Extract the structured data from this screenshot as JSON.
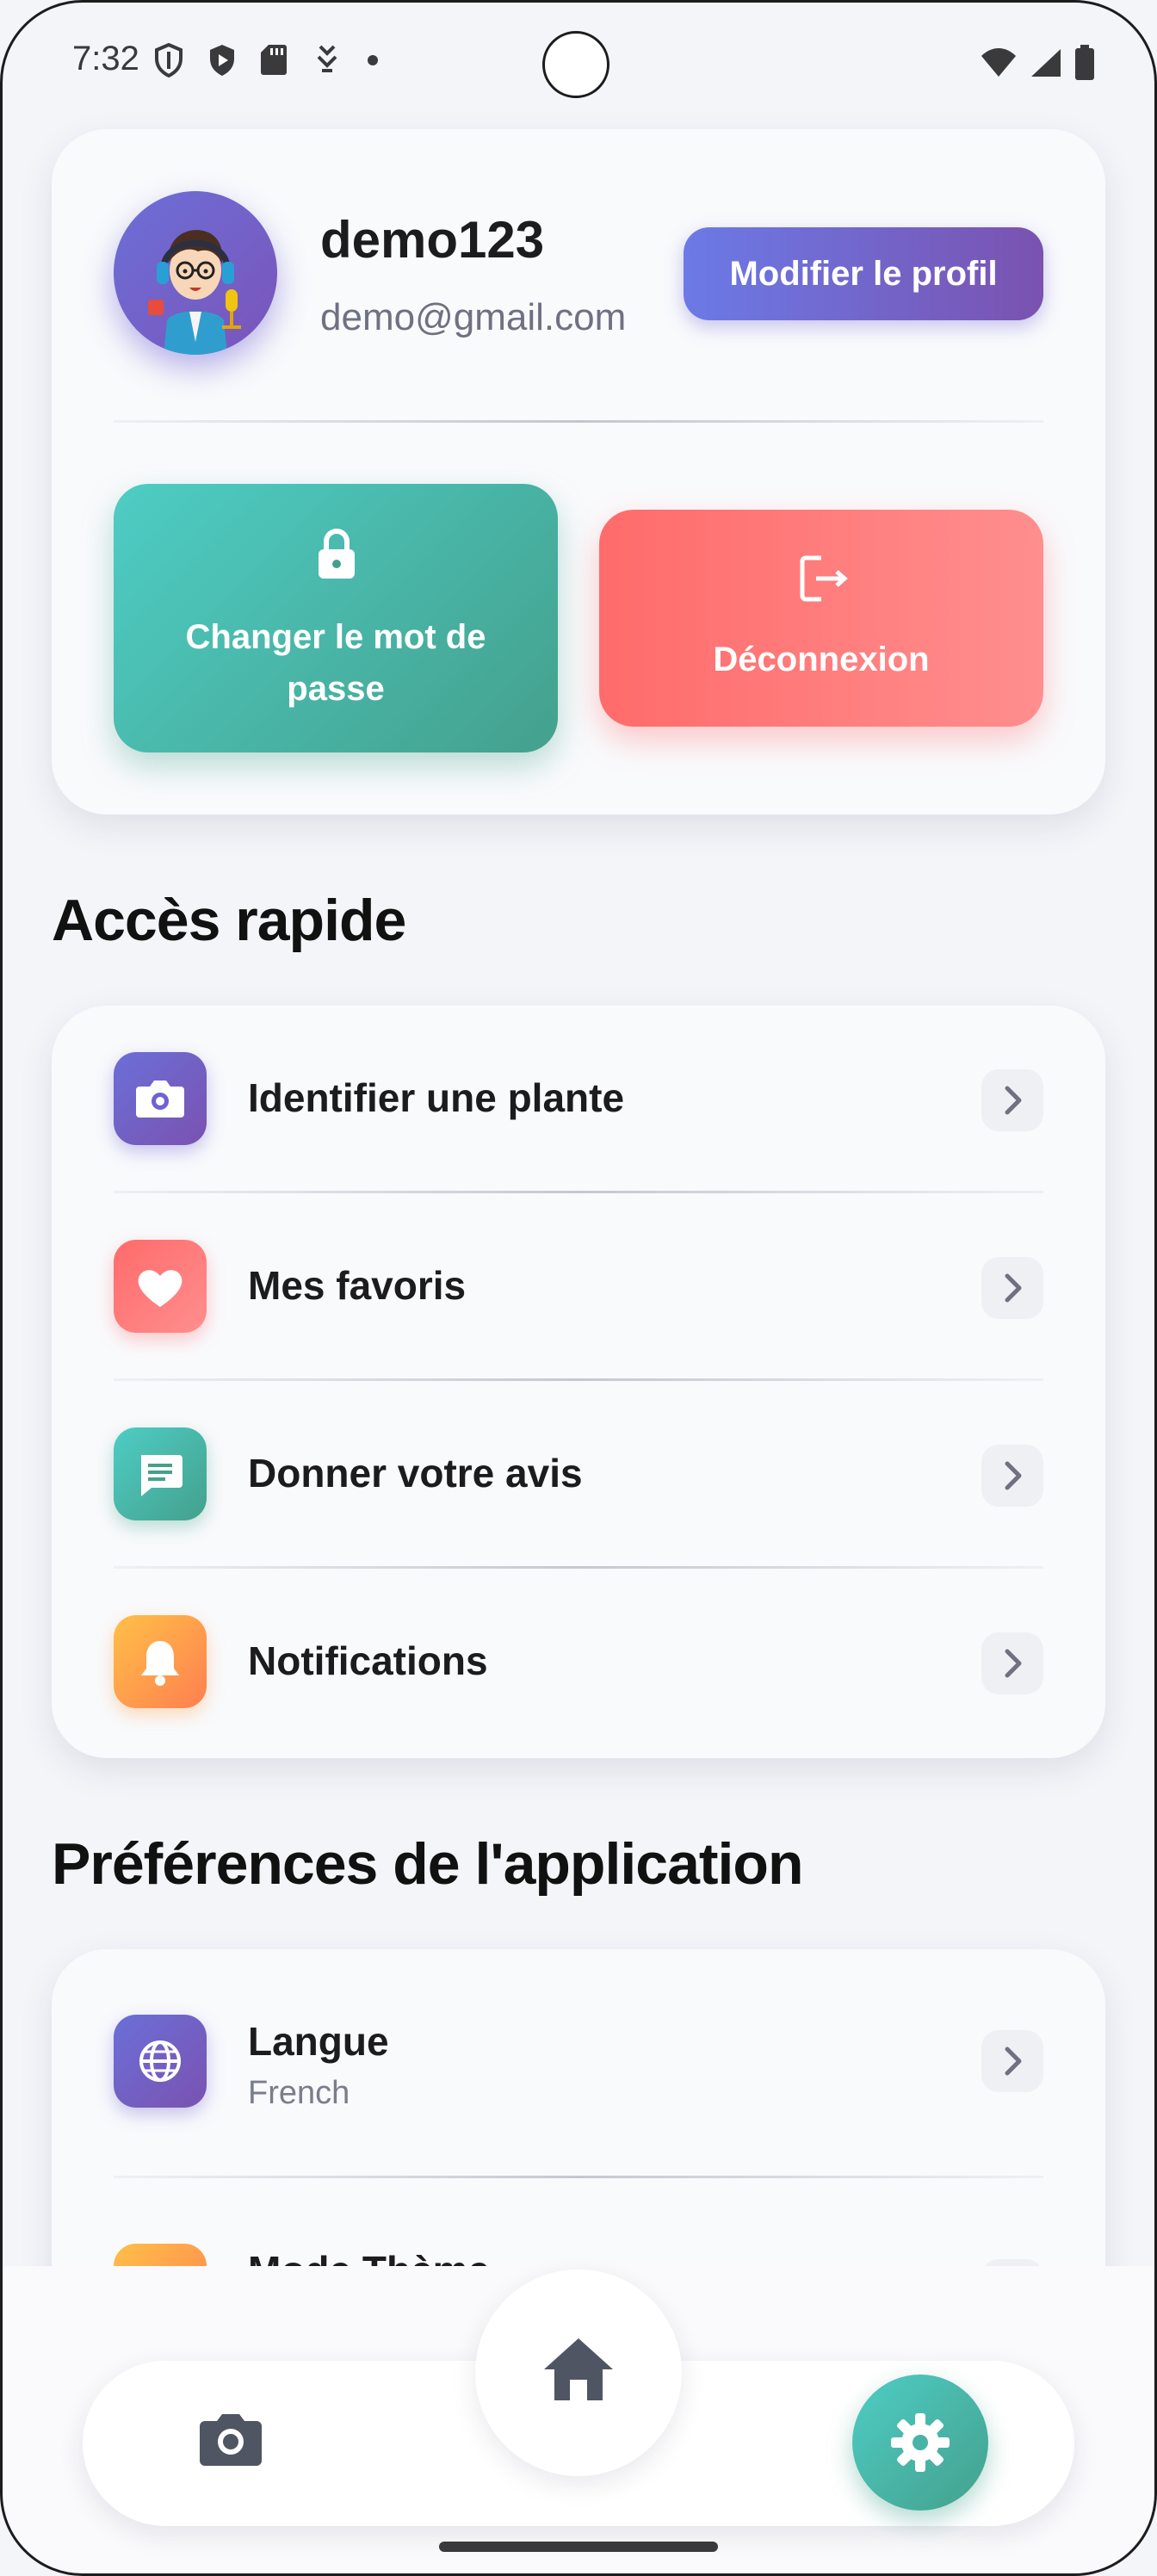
{
  "status_bar": {
    "time": "7:32",
    "icons": [
      "shield-icon",
      "play-protect-icon",
      "sd-card-icon",
      "download-icon",
      "dot-icon"
    ],
    "right_icons": [
      "wifi-icon",
      "signal-icon",
      "battery-icon"
    ]
  },
  "profile": {
    "username": "demo123",
    "email": "demo@gmail.com",
    "edit_label": "Modifier le profil",
    "change_password_label_line1": "Changer le mot de",
    "change_password_label_line2": "passe",
    "logout_label": "Déconnexion"
  },
  "quick_access": {
    "title": "Accès rapide",
    "items": [
      {
        "label": "Identifier une plante",
        "icon": "camera-icon",
        "color": "#6b6fd8"
      },
      {
        "label": "Mes favoris",
        "icon": "heart-icon",
        "color": "#ff6b6b"
      },
      {
        "label": "Donner votre avis",
        "icon": "feedback-icon",
        "color": "#44a08d"
      },
      {
        "label": "Notifications",
        "icon": "bell-icon",
        "color": "#ff9f43"
      }
    ]
  },
  "preferences": {
    "title": "Préférences de l'application",
    "items": [
      {
        "label": "Langue",
        "value": "French",
        "icon": "globe-icon"
      },
      {
        "label": "Mode Thème",
        "icon": "theme-icon"
      }
    ]
  },
  "bottom_nav": {
    "items": [
      "camera-icon",
      "home-icon",
      "settings-icon"
    ],
    "active": "settings-icon"
  },
  "colors": {
    "primary": "#6b6fd8",
    "teal": "#44a08d",
    "red": "#ff6b6b",
    "orange": "#ff9f43"
  }
}
